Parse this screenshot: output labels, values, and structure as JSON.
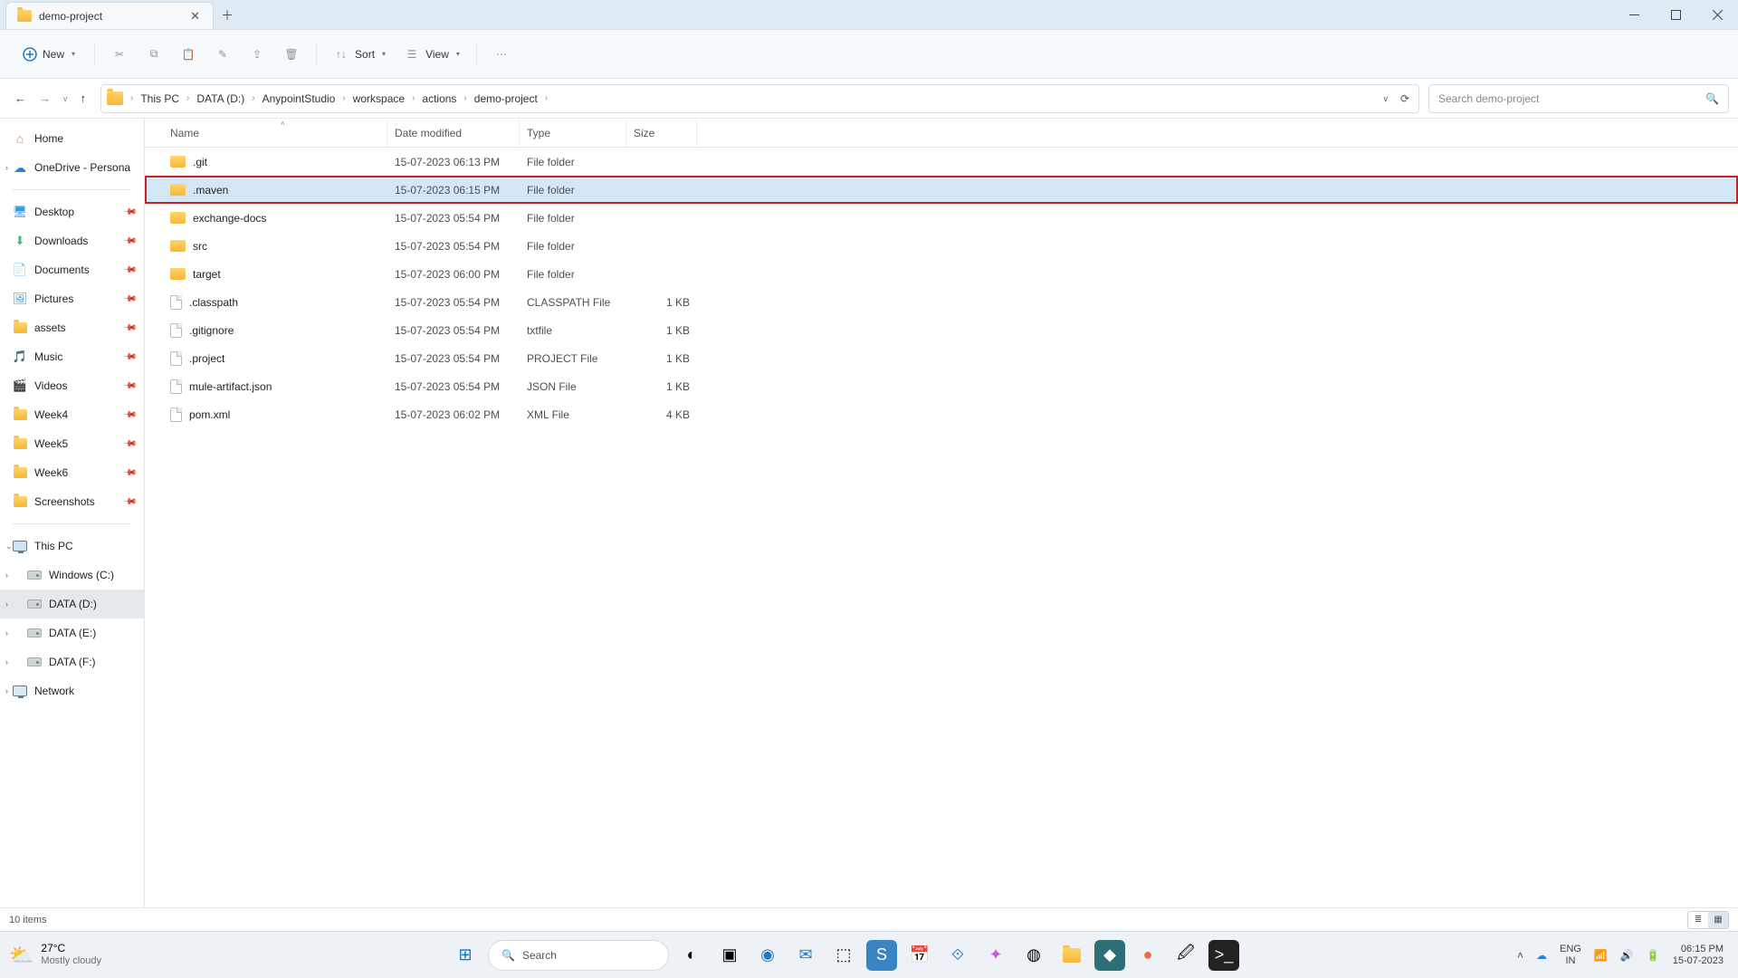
{
  "window": {
    "tab_title": "demo-project"
  },
  "toolbar": {
    "new_label": "New",
    "sort_label": "Sort",
    "view_label": "View"
  },
  "breadcrumb": {
    "items": [
      "This PC",
      "DATA (D:)",
      "AnypointStudio",
      "workspace",
      "actions",
      "demo-project"
    ]
  },
  "search": {
    "placeholder": "Search demo-project"
  },
  "sidebar": {
    "home": "Home",
    "onedrive": "OneDrive - Persona",
    "quick": [
      {
        "label": "Desktop"
      },
      {
        "label": "Downloads"
      },
      {
        "label": "Documents"
      },
      {
        "label": "Pictures"
      },
      {
        "label": "assets"
      },
      {
        "label": "Music"
      },
      {
        "label": "Videos"
      },
      {
        "label": "Week4"
      },
      {
        "label": "Week5"
      },
      {
        "label": "Week6"
      },
      {
        "label": "Screenshots"
      }
    ],
    "this_pc": "This PC",
    "drives": [
      {
        "label": "Windows (C:)"
      },
      {
        "label": "DATA (D:)",
        "selected": true
      },
      {
        "label": "DATA (E:)"
      },
      {
        "label": "DATA (F:)"
      }
    ],
    "network": "Network"
  },
  "columns": {
    "name": "Name",
    "date": "Date modified",
    "type": "Type",
    "size": "Size"
  },
  "files": [
    {
      "icon": "folder",
      "name": ".git",
      "date": "15-07-2023 06:13 PM",
      "type": "File folder",
      "size": ""
    },
    {
      "icon": "folder",
      "name": ".maven",
      "date": "15-07-2023 06:15 PM",
      "type": "File folder",
      "size": "",
      "selected": true,
      "highlighted": true
    },
    {
      "icon": "folder",
      "name": "exchange-docs",
      "date": "15-07-2023 05:54 PM",
      "type": "File folder",
      "size": ""
    },
    {
      "icon": "folder",
      "name": "src",
      "date": "15-07-2023 05:54 PM",
      "type": "File folder",
      "size": ""
    },
    {
      "icon": "folder",
      "name": "target",
      "date": "15-07-2023 06:00 PM",
      "type": "File folder",
      "size": ""
    },
    {
      "icon": "file",
      "name": ".classpath",
      "date": "15-07-2023 05:54 PM",
      "type": "CLASSPATH File",
      "size": "1 KB"
    },
    {
      "icon": "file",
      "name": ".gitignore",
      "date": "15-07-2023 05:54 PM",
      "type": "txtfile",
      "size": "1 KB"
    },
    {
      "icon": "file",
      "name": ".project",
      "date": "15-07-2023 05:54 PM",
      "type": "PROJECT File",
      "size": "1 KB"
    },
    {
      "icon": "file",
      "name": "mule-artifact.json",
      "date": "15-07-2023 05:54 PM",
      "type": "JSON File",
      "size": "1 KB"
    },
    {
      "icon": "file",
      "name": "pom.xml",
      "date": "15-07-2023 06:02 PM",
      "type": "XML File",
      "size": "4 KB"
    }
  ],
  "status": {
    "item_count": "10 items"
  },
  "taskbar": {
    "weather_temp": "27°C",
    "weather_desc": "Mostly cloudy",
    "search_placeholder": "Search",
    "lang_top": "ENG",
    "lang_bottom": "IN",
    "time": "06:15 PM",
    "date": "15-07-2023"
  }
}
